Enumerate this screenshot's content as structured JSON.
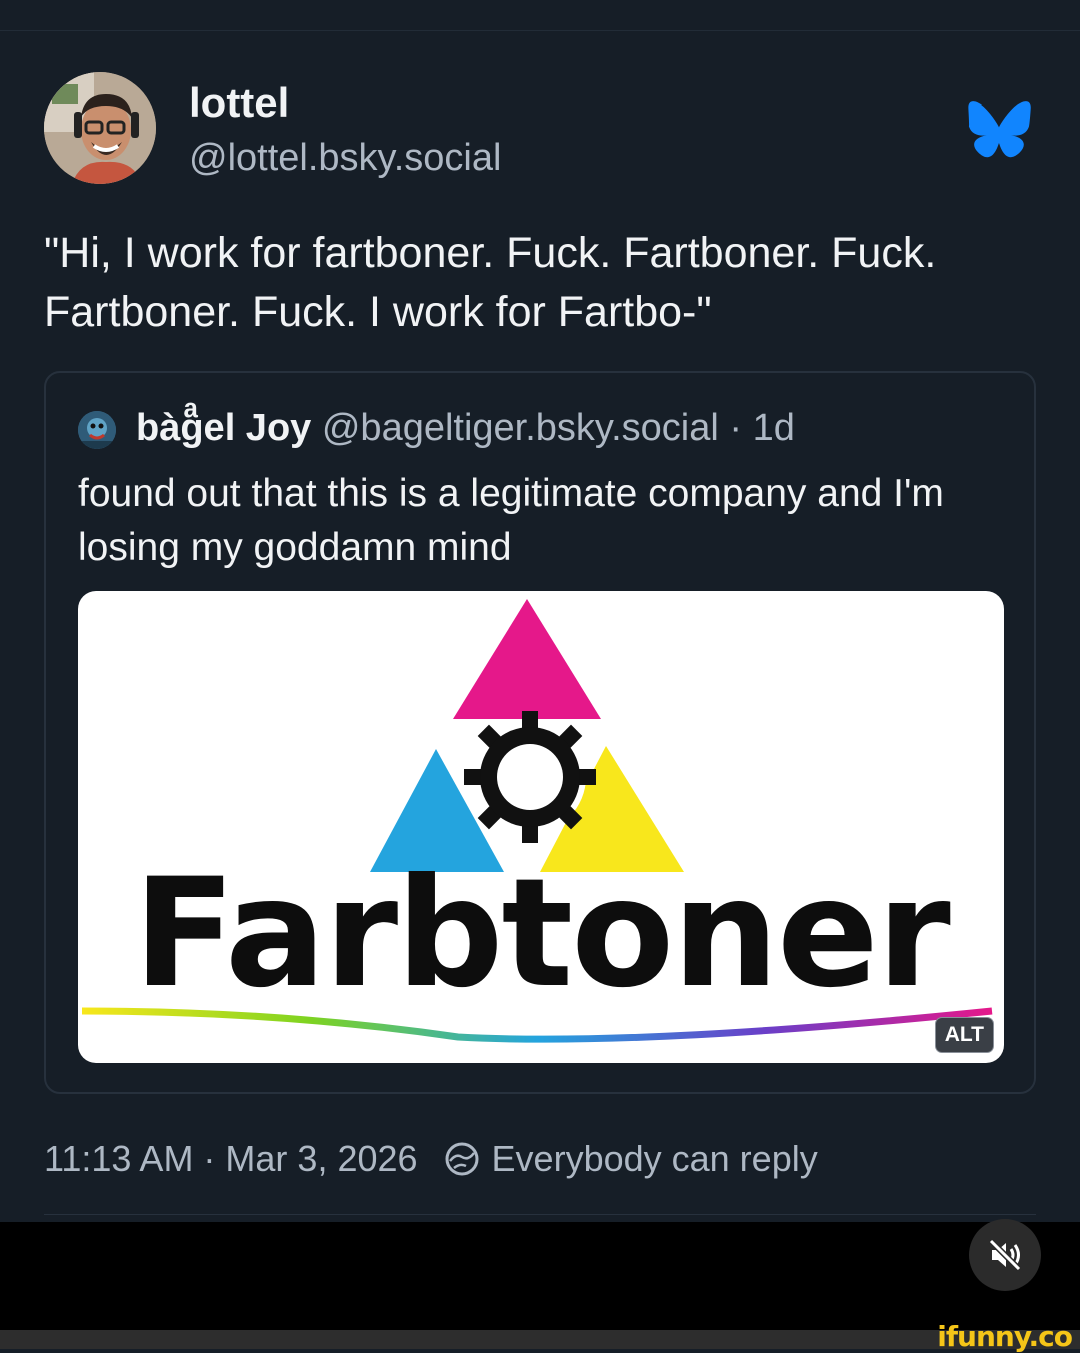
{
  "post": {
    "author_name": "lottel",
    "author_handle": "@lottel.bsky.social",
    "text": "\"Hi, I work for fartboner. Fuck. Fartboner. Fuck. Fartboner. Fuck. I work for Fartbo-\"",
    "timestamp": "11:13 AM · Mar 3, 2026",
    "reply_setting": "Everybody can reply"
  },
  "quote": {
    "author_name": "bàgͣel Joy",
    "author_handle": "@bageltiger.bsky.social",
    "age": "· 1d",
    "text": "found out that this is a legitimate company and I'm losing my goddamn mind",
    "image": {
      "logo_text": "Farbtoner",
      "alt_badge": "ALT"
    }
  },
  "watermark": "ifunny.co",
  "colors": {
    "background": "#161e27",
    "bluesky": "#1185fe",
    "magenta": "#e5188a",
    "cyan": "#24a4de",
    "yellow": "#f8e71c",
    "watermark": "#f5c518"
  },
  "icons": [
    "bluesky-butterfly-icon",
    "reply-settings-icon",
    "speaker-muted-icon"
  ]
}
